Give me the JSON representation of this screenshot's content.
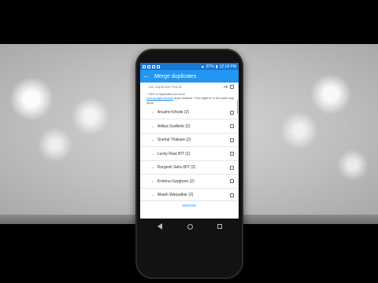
{
  "status_bar": {
    "battery": "87%",
    "time": "12:18 PM"
  },
  "app_bar": {
    "title": "Merge duplicates"
  },
  "list_header": {
    "found_text": "132 duplicates found",
    "all_label": "All"
  },
  "notice": {
    "prefix": "* 25% of duplicates are from",
    "link": "com.google.android",
    "suffix": " apps lastyear. This might be a 3rd party app issue"
  },
  "items": [
    {
      "label": "Anushri Khode (2)"
    },
    {
      "label": "Aditya Godbole (2)"
    },
    {
      "label": "Snehal Thakare (2)"
    },
    {
      "label": "Lucky Raut BIT (2)"
    },
    {
      "label": "Durgesh Sahu BIT (2)"
    },
    {
      "label": "Krishna Gargharo (2)"
    },
    {
      "label": "Akash Warpatkar (2)"
    }
  ],
  "bottom": {
    "merge_label": "MERGE"
  },
  "colors": {
    "status_bar": "#1976d2",
    "app_bar": "#2196f3",
    "accent": "#1e88e5"
  }
}
